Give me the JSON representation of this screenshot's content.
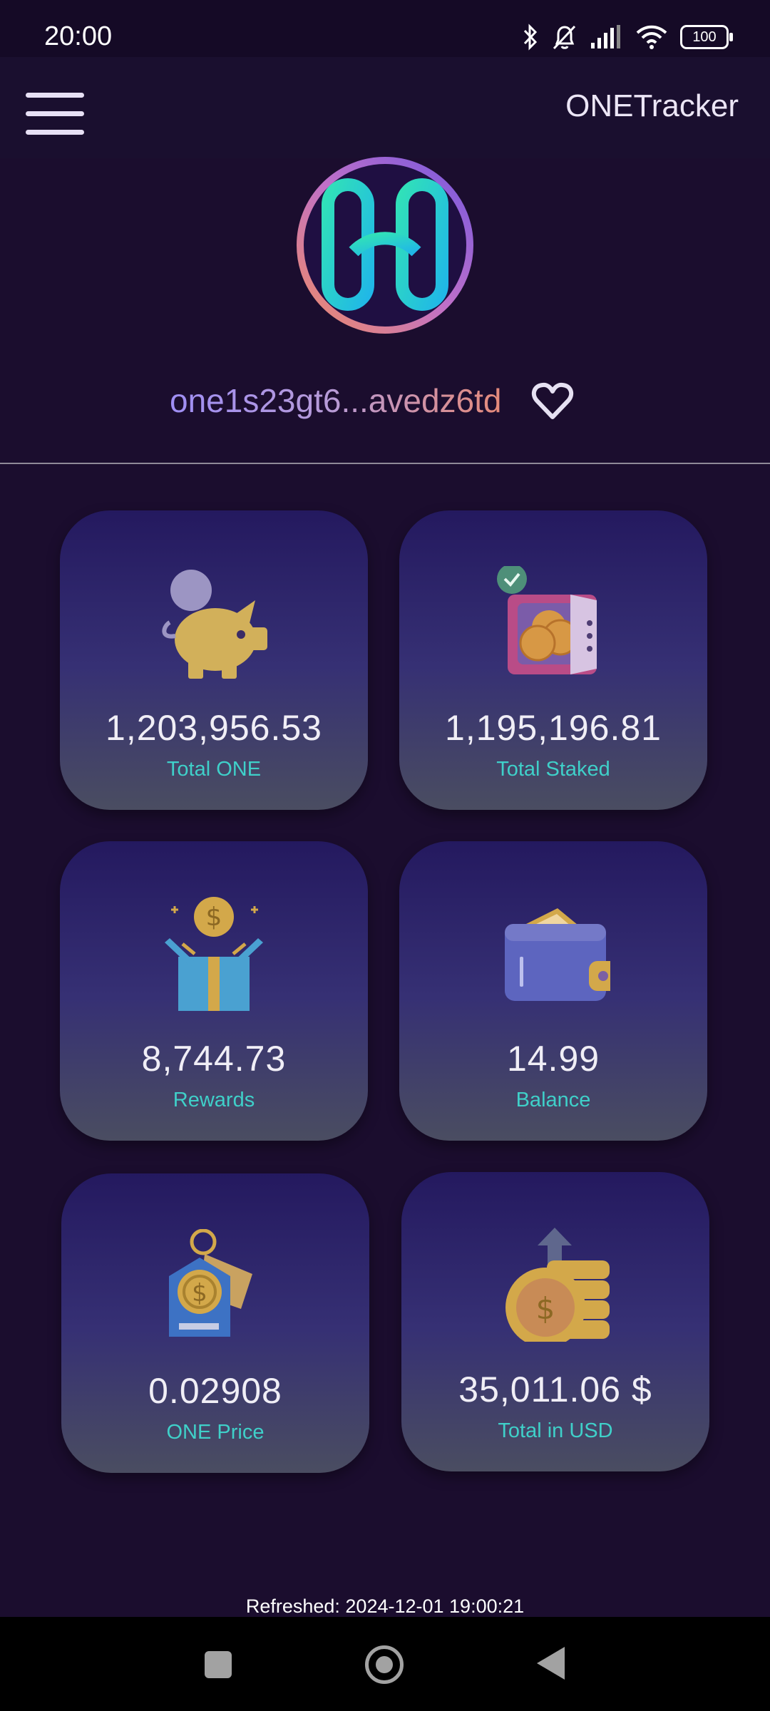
{
  "status_bar": {
    "time": "20:00",
    "battery": "100",
    "icons": [
      "bluetooth-icon",
      "bell-off-icon",
      "signal-icon",
      "wifi-icon",
      "battery-icon"
    ]
  },
  "app_bar": {
    "title": "ONETracker",
    "menu_icon": "menu-icon"
  },
  "wallet": {
    "address": "one1s23gt6...avedz6td",
    "favorite_icon": "heart-outline-icon"
  },
  "cards": [
    {
      "value": "1,203,956.53",
      "label": "Total ONE",
      "icon": "piggy-bank-icon"
    },
    {
      "value": "1,195,196.81",
      "label": "Total Staked",
      "icon": "safe-icon"
    },
    {
      "value": "8,744.73",
      "label": "Rewards",
      "icon": "gift-box-icon"
    },
    {
      "value": "14.99",
      "label": "Balance",
      "icon": "wallet-icon"
    },
    {
      "value": "0.02908",
      "label": "ONE Price",
      "icon": "price-tag-icon"
    },
    {
      "value": "35,011.06 $",
      "label": "Total in USD",
      "icon": "coins-upload-icon"
    }
  ],
  "footer": {
    "refreshed": "Refreshed: 2024-12-01 19:00:21"
  },
  "nav_bar": {
    "icons": [
      "square-icon",
      "home-icon",
      "back-icon"
    ]
  },
  "colors": {
    "background": "#1b0d2e",
    "card_label": "#3fd0c9",
    "card_top": "#24195f",
    "card_bottom": "#4a4d61"
  }
}
